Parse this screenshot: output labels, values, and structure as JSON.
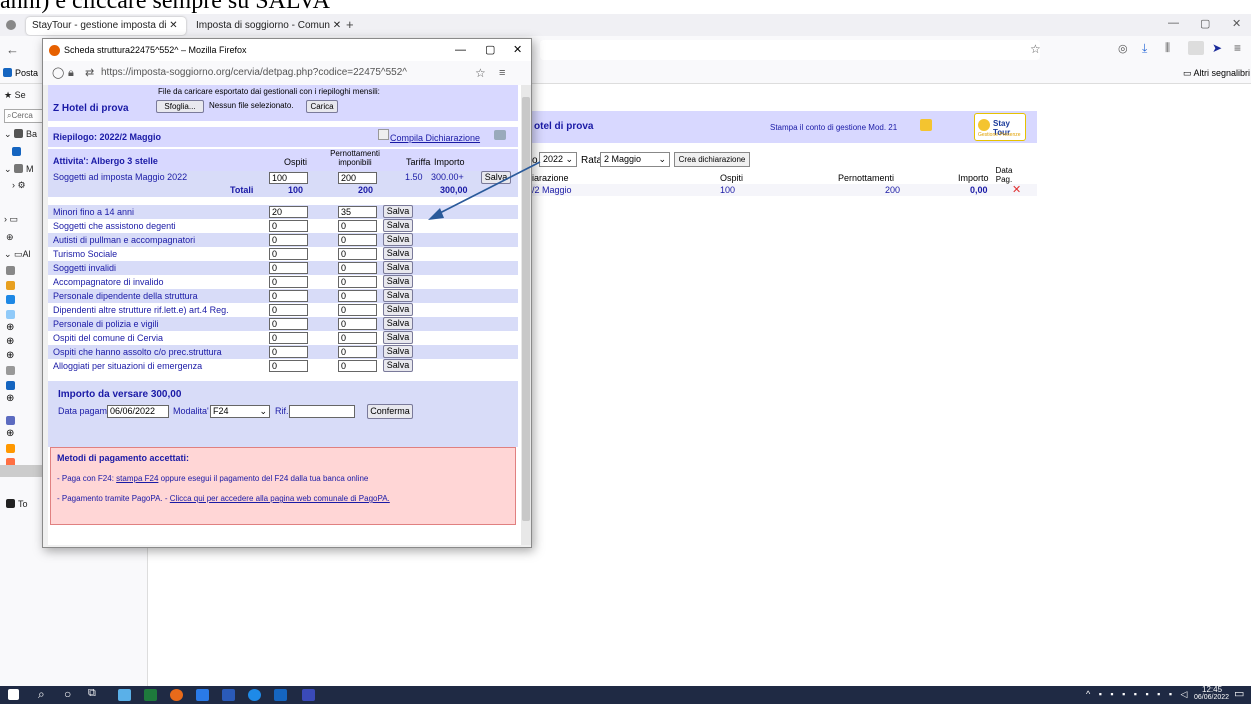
{
  "doc_text": "anni) e cliccare sempre su SALVA",
  "browser": {
    "tabs": [
      {
        "label": "StayTour - gestione imposta di ✕"
      },
      {
        "label": "Imposta di soggiorno - Comun ✕"
      }
    ],
    "new_tab": "+",
    "window_controls": [
      "—",
      "▢",
      "✕"
    ],
    "bookmarks": {
      "left": "Posta",
      "right": "Altri segnalibri"
    }
  },
  "sidebar": {
    "items": [
      "Se",
      "Cerca",
      "Ba",
      "",
      "M",
      "",
      "",
      "",
      "Al",
      "",
      "",
      "",
      "",
      "",
      "",
      "",
      "",
      "",
      "",
      "",
      "",
      "",
      "To"
    ]
  },
  "main_page": {
    "hotel": "otel di prova",
    "stampa": "Stampa il conto di gestione Mod. 21",
    "logo_title": "Stay Tour",
    "logo_sub": "Gestione Presenze",
    "year_prefix": "o",
    "year": "2022",
    "rata_label": "Rata",
    "rata": "2 Maggio",
    "crea_button": "Crea dichiarazione",
    "col_dichiarazione": "iarazione",
    "col_ospiti": "Ospiti",
    "col_pernottamenti": "Pernottamenti",
    "col_importo": "Importo",
    "col_data": "Data Pag.",
    "row_label": "/2 Maggio",
    "row_ospiti": "100",
    "row_pernottamenti": "200",
    "row_importo": "0,00"
  },
  "popup": {
    "title": "Scheda struttura22475^552^ – Mozilla Firefox",
    "url": "https://imposta-soggiorno.org/cervia/detpag.php?codice=22475^552^",
    "hotel_name": "Z Hotel di prova",
    "file_text": "File da caricare esportato dai gestionali con i riepiloghi mensili:",
    "browse_button": "Sfoglia...",
    "no_file": "Nessun file selezionato.",
    "upload_button": "Carica",
    "riepilogo": "Riepilogo: 2022/2 Maggio",
    "compila": "Compila Dichiarazione",
    "attivita": "Attivita': Albergo 3 stelle",
    "col_ospiti": "Ospiti",
    "col_pernottamenti": "Pernottamenti imponibili",
    "col_tariffa": "Tariffa",
    "col_importo": "Importo",
    "sogg_label": "Soggetti ad imposta Maggio 2022",
    "sogg_ospiti": "100",
    "sogg_pern": "200",
    "sogg_tariffa": "1.50",
    "sogg_importo": "300.00+",
    "save_label": "Salva",
    "totali_label": "Totali",
    "tot_ospiti": "100",
    "tot_pern": "200",
    "tot_importo": "300,00",
    "exemptions": [
      {
        "label": "Minori fino a 14 anni",
        "ospiti": "20",
        "pern": "35"
      },
      {
        "label": "Soggetti che assistono degenti",
        "ospiti": "0",
        "pern": "0"
      },
      {
        "label": "Autisti di pullman e accompagnatori",
        "ospiti": "0",
        "pern": "0"
      },
      {
        "label": "Turismo Sociale",
        "ospiti": "0",
        "pern": "0"
      },
      {
        "label": "Soggetti invalidi",
        "ospiti": "0",
        "pern": "0"
      },
      {
        "label": "Accompagnatore di invalido",
        "ospiti": "0",
        "pern": "0"
      },
      {
        "label": "Personale dipendente della struttura",
        "ospiti": "0",
        "pern": "0"
      },
      {
        "label": "Dipendenti altre strutture rif.lett.e) art.4 Reg.",
        "ospiti": "0",
        "pern": "0"
      },
      {
        "label": "Personale di polizia e vigili",
        "ospiti": "0",
        "pern": "0"
      },
      {
        "label": "Ospiti del comune di Cervia",
        "ospiti": "0",
        "pern": "0"
      },
      {
        "label": "Ospiti che hanno assolto c/o prec.struttura",
        "ospiti": "0",
        "pern": "0"
      },
      {
        "label": "Alloggiati per situazioni di emergenza",
        "ospiti": "0",
        "pern": "0"
      }
    ],
    "importo_versare": "Importo da versare 300,00",
    "data_pagam_label": "Data pagam.",
    "data_pagam": "06/06/2022",
    "modalita_label": "Modalita'",
    "modalita": "F24",
    "rif_label": "Rif.",
    "rif_value": "",
    "conferma_button": "Conferma",
    "metodi_title": "Metodi di pagamento accettati:",
    "metodo1_pre": "- Paga con F24: ",
    "metodo1_link": "stampa F24",
    "metodo1_post": " oppure esegui il pagamento del F24 dalla tua banca online",
    "metodo2_pre": "- Pagamento tramite PagoPA. - ",
    "metodo2_link": "Clicca qui per accedere alla pagina web comunale di PagoPA."
  },
  "taskbar": {
    "time": "12:45",
    "date": "06/06/2022"
  },
  "colors": {
    "accent_lavender": "#d8d8ff",
    "link_blue": "#1a1aa6",
    "error_red": "#e03030",
    "annotation_arrow": "#2a5a9a"
  }
}
